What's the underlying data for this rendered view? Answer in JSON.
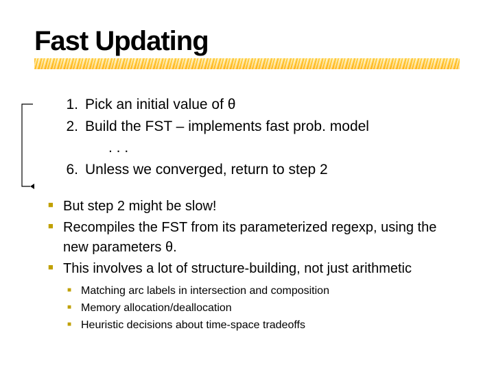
{
  "title": "Fast Updating",
  "steps": {
    "s1": {
      "num": "1.",
      "text": "Pick an initial value of θ"
    },
    "s2": {
      "num": "2.",
      "text": "Build the FST – implements fast prob. model"
    },
    "dots": ". . .",
    "s6": {
      "num": "6.",
      "text": "Unless we converged, return to step 2"
    }
  },
  "bullets": [
    "But step 2 might be slow!",
    "Recompiles the FST from its parameterized regexp, using the new parameters θ.",
    "This involves a lot of structure-building, not just arithmetic"
  ],
  "subbullets": [
    "Matching arc labels in intersection and composition",
    "Memory allocation/deallocation",
    "Heuristic decisions about time-space tradeoffs"
  ]
}
